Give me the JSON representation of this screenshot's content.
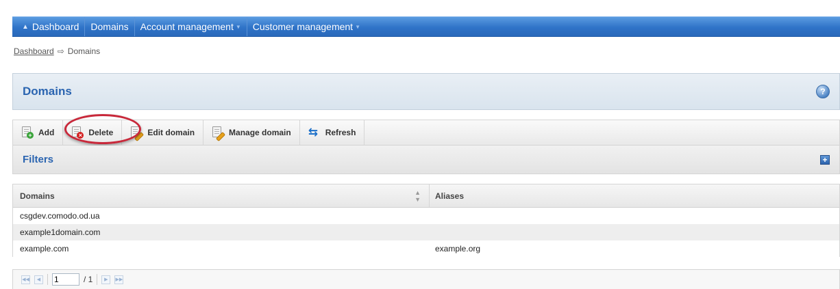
{
  "nav": {
    "items": [
      {
        "label": "Dashboard",
        "icon": "home-icon"
      },
      {
        "label": "Domains"
      },
      {
        "label": "Account management",
        "icon": "chevron-down-icon"
      },
      {
        "label": "Customer management",
        "icon": "chevron-down-icon"
      }
    ]
  },
  "breadcrumb": {
    "root": "Dashboard",
    "current": "Domains"
  },
  "page": {
    "title": "Domains"
  },
  "toolbar": {
    "add_label": "Add",
    "delete_label": "Delete",
    "edit_label": "Edit domain",
    "manage_label": "Manage domain",
    "refresh_label": "Refresh"
  },
  "filters": {
    "title": "Filters"
  },
  "table": {
    "columns": [
      "Domains",
      "Aliases"
    ],
    "rows": [
      {
        "domain": "csgdev.comodo.od.ua",
        "alias": ""
      },
      {
        "domain": "example1domain.com",
        "alias": ""
      },
      {
        "domain": "example.com",
        "alias": "example.org"
      }
    ]
  },
  "pager": {
    "current_page": "1",
    "total_label": "/ 1"
  },
  "colors": {
    "nav_blue": "#2f73c8",
    "title_blue": "#2a64b0",
    "highlight_red": "#c8283a"
  }
}
